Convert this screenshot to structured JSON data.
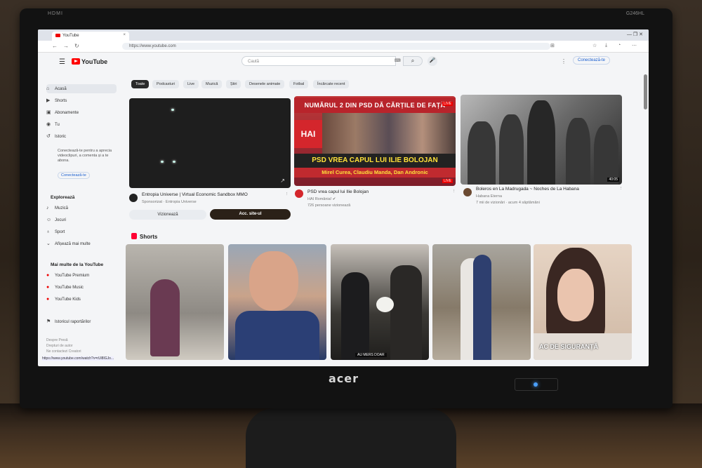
{
  "monitor": {
    "brand": "acer",
    "top_left_label": "HDMI",
    "top_right_label": "G246HL"
  },
  "browser": {
    "tab_title": "YouTube",
    "url": "https://www.youtube.com",
    "window_controls": "—  ❐  ✕"
  },
  "header": {
    "logo_text": "YouTube",
    "search_placeholder": "Caută",
    "signin_label": "Conectează-te"
  },
  "sidebar": {
    "items": [
      {
        "icon": "⌂",
        "label": "Acasă"
      },
      {
        "icon": "▶",
        "label": "Shorts"
      },
      {
        "icon": "▣",
        "label": "Abonamente"
      },
      {
        "icon": "◉",
        "label": "Tu"
      },
      {
        "icon": "↺",
        "label": "Istoric"
      }
    ],
    "note": "Conectează-te pentru a aprecia videoclipuri, a comenta și a te abona.",
    "signin_label": "Conectează-te",
    "explore_heading": "Explorează",
    "explore_items": [
      {
        "icon": "♪",
        "label": "Muzică"
      },
      {
        "icon": "☺",
        "label": "Jocuri"
      },
      {
        "icon": "♁",
        "label": "Sport"
      },
      {
        "icon": "⌄",
        "label": "Afișează mai multe"
      }
    ],
    "more_heading": "Mai multe de la YouTube",
    "more_items": [
      {
        "icon": "●",
        "label": "YouTube Premium"
      },
      {
        "icon": "●",
        "label": "YouTube Music"
      },
      {
        "icon": "●",
        "label": "YouTube Kids"
      }
    ],
    "report_label": "Istoricul raportărilor",
    "footer1": "Despre  Presă",
    "footer2": "Drepturi de autor",
    "footer3": "Ne contactezi  Creatori",
    "status_url": "https://www.youtube.com/watch?v=rUl8IGJo..."
  },
  "chips": [
    "Toate",
    "Podcasturi",
    "Live",
    "Muzică",
    "Știri",
    "Desenele animate",
    "Fotbal",
    "Încărcate recent"
  ],
  "videos": [
    {
      "title": "Entropia Universe | Virtual Economic Sandbox MMO",
      "meta": "Sponsorizat · Entropia Universe",
      "btn_watch": "Vizionează",
      "btn_site": "Acc. site-ul"
    },
    {
      "title": "PSD vrea capul lui Ilie Bolojan",
      "channel": "HAI România! ✔",
      "meta": "726 persoane vizionează",
      "thumb_top": "NUMĂRUL 2 DIN PSD DĂ CĂRȚILE DE FAȚĂ",
      "thumb_mid": "PSD VREA CAPUL LUI ILIE BOLOJAN",
      "thumb_bottom": "Mirel Curea, Claudiu Manda, Dan Andronic",
      "thumb_badge": "HAI",
      "live": "LIVE"
    },
    {
      "title": "Boleros en La Madrugada ~ Noches de La Habana",
      "channel": "Habana Eterna",
      "meta": "7 mii de vizionări · acum 4 săptămâni",
      "duration": "40:05"
    }
  ],
  "shorts": {
    "heading": "Shorts",
    "caption3": "AU MERS DOAR",
    "overlay5": "AC DE SIGURANȚĂ"
  },
  "colors": {
    "yt_red": "#ff0000",
    "link_blue": "#1a5fd0",
    "led_blue": "#4aa0ff"
  }
}
